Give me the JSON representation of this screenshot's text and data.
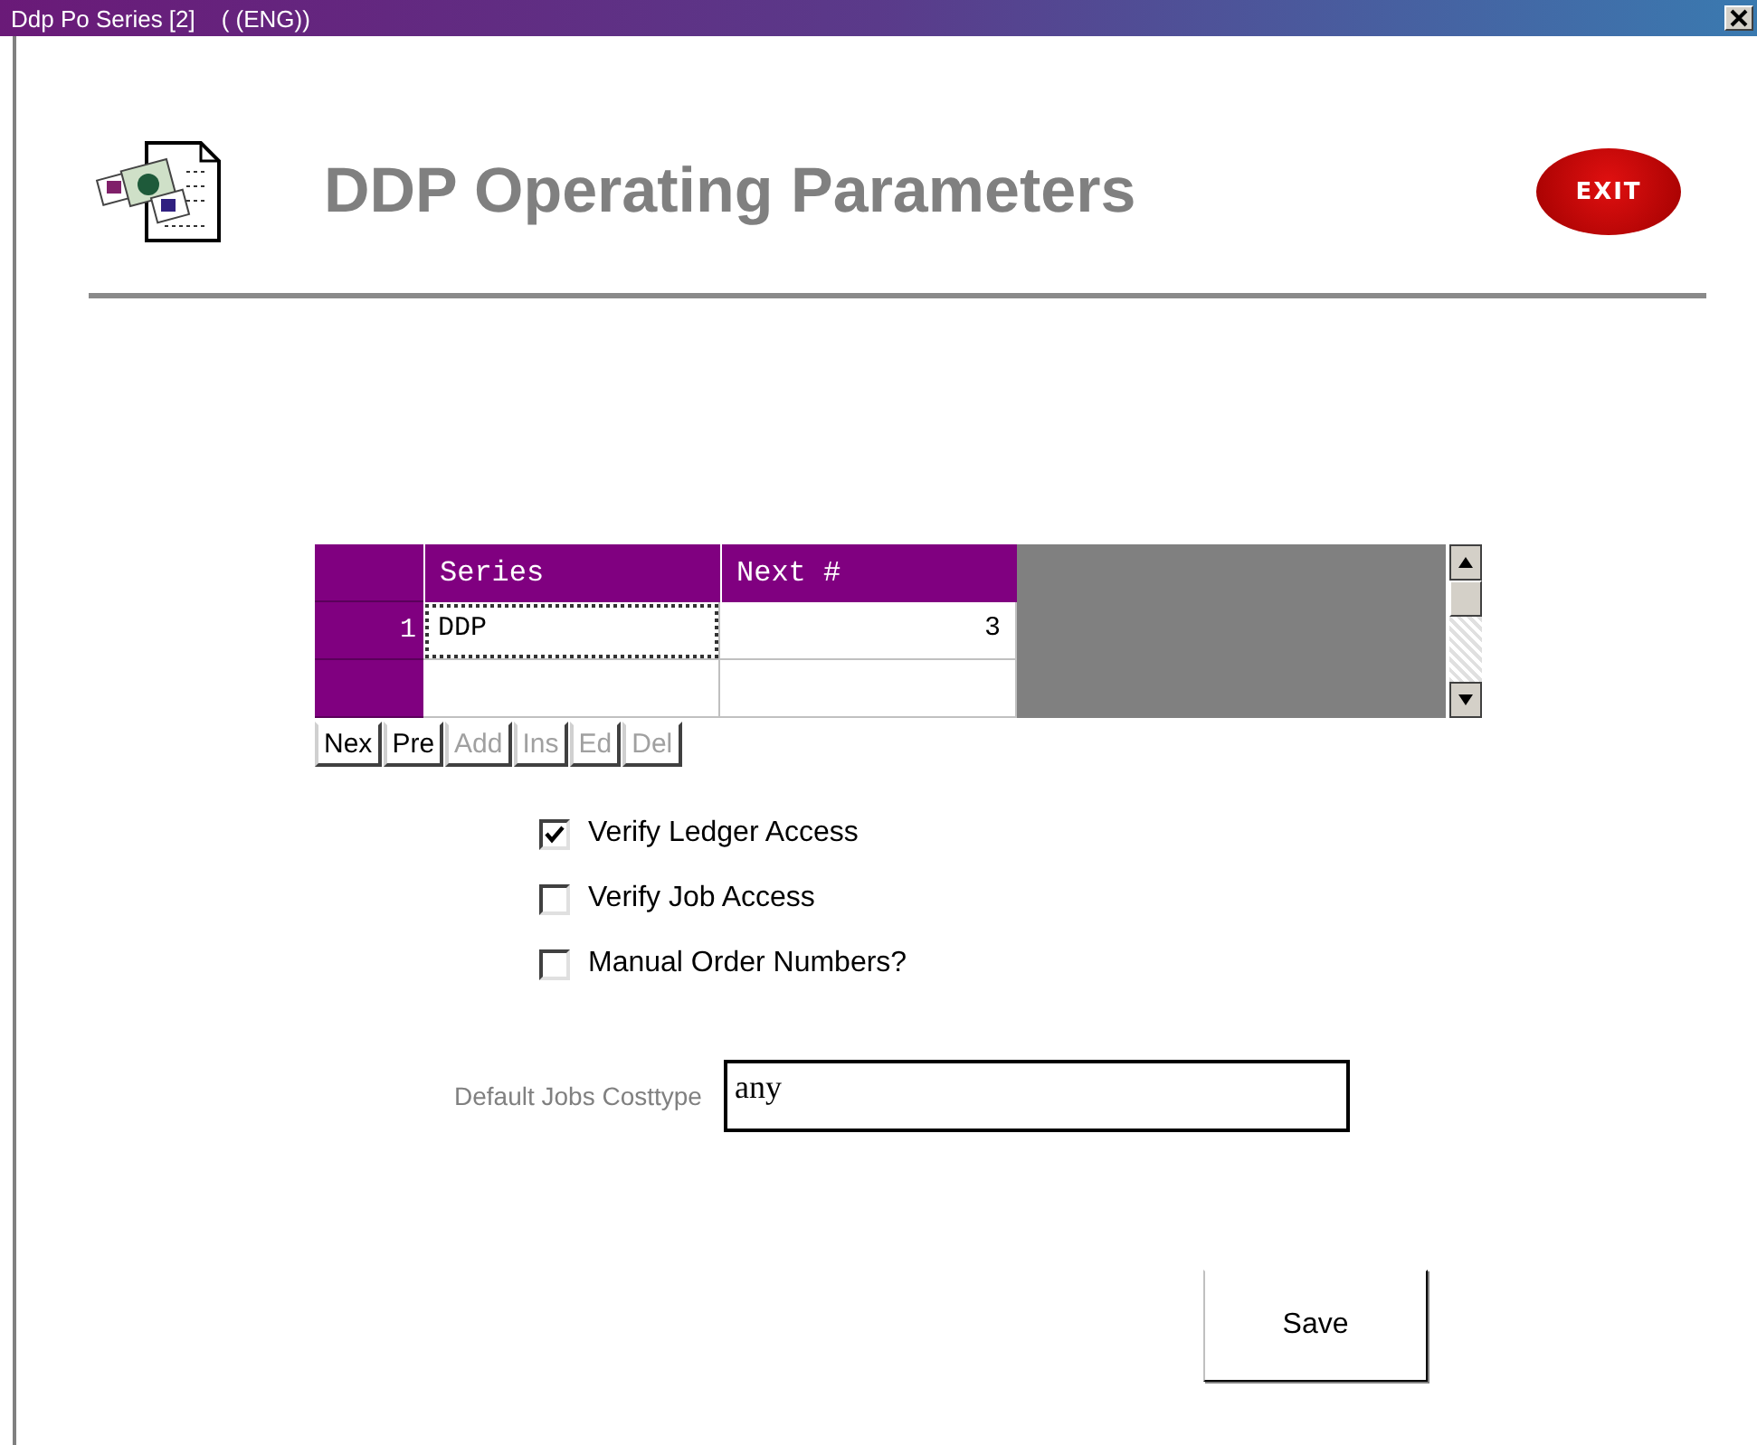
{
  "window": {
    "title": "Ddp Po Series [2]    ( (ENG))"
  },
  "header": {
    "title": "DDP Operating Parameters",
    "exit_label": "EXIT"
  },
  "grid": {
    "columns": [
      "Series",
      "Next #"
    ],
    "rows": [
      {
        "number": "1",
        "series": "DDP",
        "next": "3",
        "selected": true
      }
    ]
  },
  "nav_buttons": [
    {
      "label": "Nex",
      "disabled": false
    },
    {
      "label": "Pre",
      "disabled": false
    },
    {
      "label": "Add",
      "disabled": true
    },
    {
      "label": "Ins",
      "disabled": true
    },
    {
      "label": "Ed",
      "disabled": true
    },
    {
      "label": "Del",
      "disabled": true
    }
  ],
  "options": [
    {
      "label": "Verify Ledger Access",
      "checked": true
    },
    {
      "label": "Verify Job Access",
      "checked": false
    },
    {
      "label": "Manual Order Numbers?",
      "checked": false
    }
  ],
  "costtype": {
    "label": "Default Jobs Costtype",
    "value": "any"
  },
  "save_button": "Save"
}
